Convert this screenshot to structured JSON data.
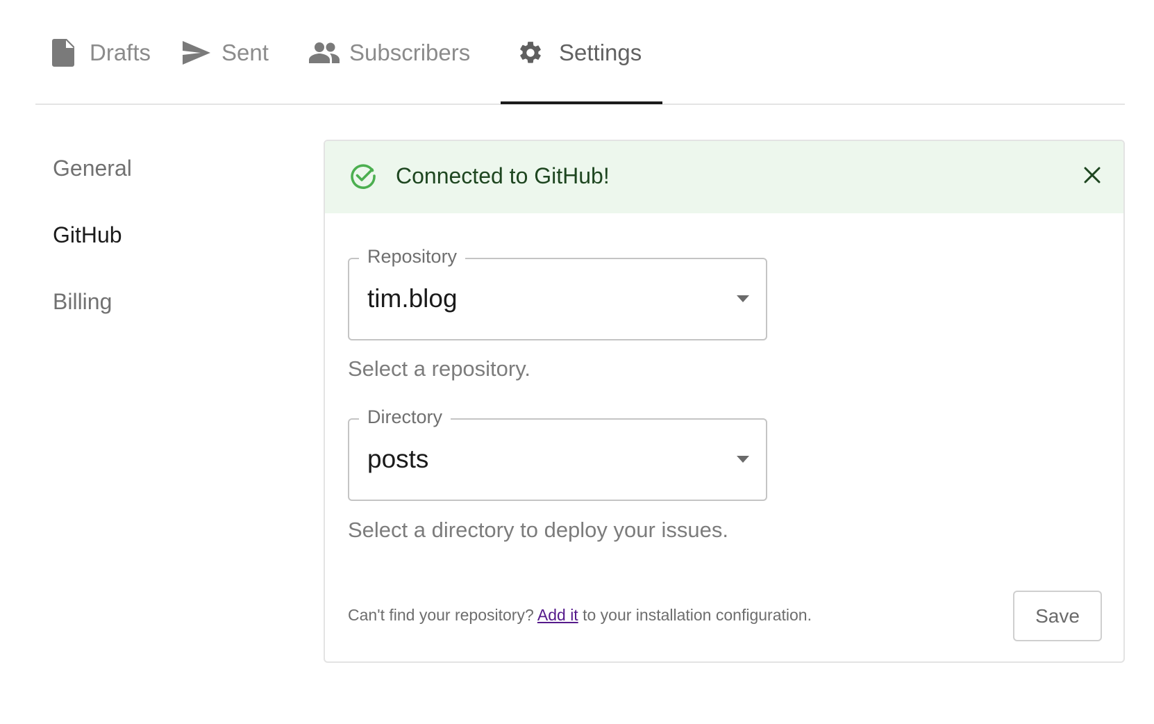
{
  "tabs": [
    {
      "label": "Drafts",
      "icon": "document-icon"
    },
    {
      "label": "Sent",
      "icon": "send-icon"
    },
    {
      "label": "Subscribers",
      "icon": "people-icon"
    },
    {
      "label": "Settings",
      "icon": "gear-icon",
      "active": true
    }
  ],
  "sidebar": {
    "items": [
      {
        "label": "General"
      },
      {
        "label": "GitHub",
        "active": true
      },
      {
        "label": "Billing"
      }
    ]
  },
  "alert": {
    "message": "Connected to GitHub!",
    "icon": "check-circle-icon",
    "close_icon": "close-icon"
  },
  "form": {
    "repository": {
      "label": "Repository",
      "value": "tim.blog",
      "helper": "Select a repository."
    },
    "directory": {
      "label": "Directory",
      "value": "posts",
      "helper": "Select a directory to deploy your issues."
    }
  },
  "footer": {
    "prefix": "Can't find your repository? ",
    "link": "Add it",
    "suffix": " to your installation configuration."
  },
  "save_label": "Save",
  "colors": {
    "success_bg": "#edf7ed",
    "success_text": "#1e4620",
    "success_icon": "#4caf50",
    "active_tab_underline": "#1c1c1c",
    "link": "#551a8b"
  }
}
